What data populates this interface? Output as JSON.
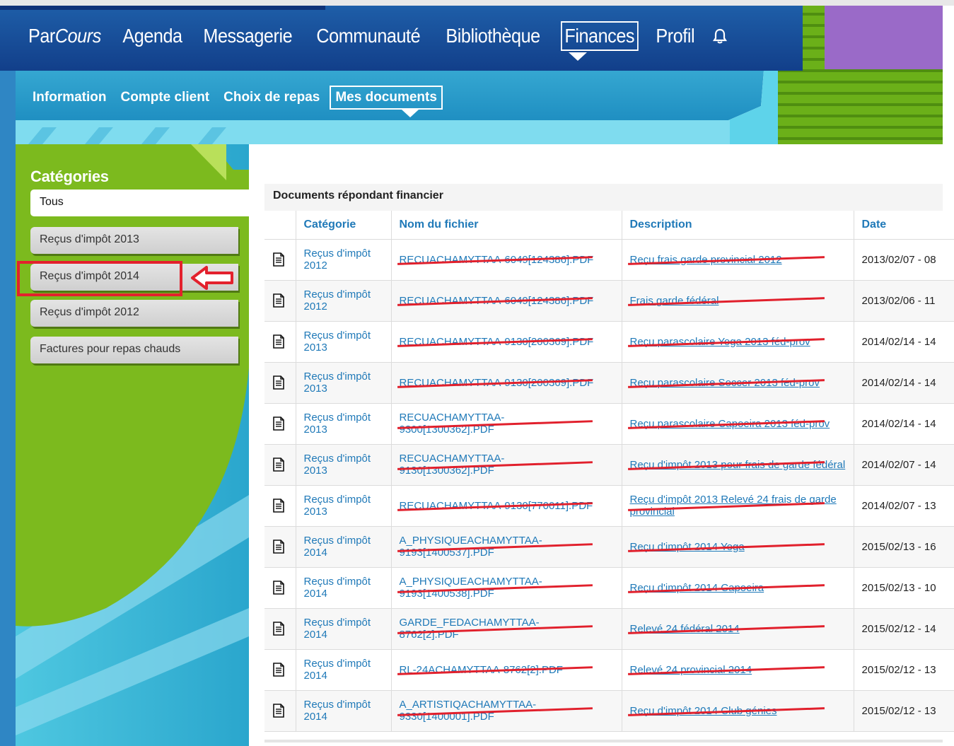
{
  "topnav": {
    "brand_par": "Par",
    "brand_cours": "Cours",
    "items": [
      "Agenda",
      "Messagerie",
      "Communauté",
      "Bibliothèque",
      "Finances",
      "Profil"
    ],
    "active": "Finances"
  },
  "subnav": {
    "items": [
      "Information",
      "Compte client",
      "Choix de repas",
      "Mes documents"
    ],
    "active": "Mes documents"
  },
  "categories": {
    "title": "Catégories",
    "items": [
      "Tous",
      "Reçus d'impôt 2013",
      "Reçus d'impôt 2014",
      "Reçus d'impôt 2012",
      "Factures pour repas chauds"
    ]
  },
  "panel": {
    "title": "Documents répondant financier",
    "columns": [
      "Catégorie",
      "Nom du fichier",
      "Description",
      "Date"
    ]
  },
  "rows": [
    {
      "cat": "Reçus d'impôt 2012",
      "file": "RECUACHAMYTTAA-6049[124386].PDF",
      "desc": "Reçu frais garde provincial 2012",
      "date": "2013/02/07 - 08"
    },
    {
      "cat": "Reçus d'impôt 2012",
      "file": "RECUACHAMYTTAA-6049[124386].PDF",
      "desc": "Frais garde fédéral",
      "date": "2013/02/06 - 11"
    },
    {
      "cat": "Reçus d'impôt 2013",
      "file": "RECUACHAMYTTAA-9130[200369].PDF",
      "desc": "Reçu parascolaire Yoga 2013 féd-prov",
      "date": "2014/02/14 - 14"
    },
    {
      "cat": "Reçus d'impôt 2013",
      "file": "RECUACHAMYTTAA-9130[200369].PDF",
      "desc": "Reçu parascolaire Soccer 2013 féd-prov",
      "date": "2014/02/14 - 14"
    },
    {
      "cat": "Reçus d'impôt 2013",
      "file": "RECUACHAMYTTAA-9300[1300362].PDF",
      "desc": "Reçu parascolaire Capoeira 2013 féd-prov",
      "date": "2014/02/14 - 14"
    },
    {
      "cat": "Reçus d'impôt 2013",
      "file": "RECUACHAMYTTAA-9130[1300362].PDF",
      "desc": "Reçu d'impôt 2013 pour frais de garde fédéral",
      "date": "2014/02/07 - 14"
    },
    {
      "cat": "Reçus d'impôt 2013",
      "file": "RECUACHAMYTTAA-9130[770011].PDF",
      "desc": "Reçu d'impôt 2013 Relevé 24 frais de garde provincial",
      "date": "2014/02/07 - 13"
    },
    {
      "cat": "Reçus d'impôt 2014",
      "file": "A_PHYSIQUEACHAMYTTAA-9193[1400537].PDF",
      "desc": "Reçu d'impôt 2014 Yoga",
      "date": "2015/02/13 - 16"
    },
    {
      "cat": "Reçus d'impôt 2014",
      "file": "A_PHYSIQUEACHAMYTTAA-9193[1400538].PDF",
      "desc": "Reçu d'impôt 2014 Capoeira",
      "date": "2015/02/13 - 10"
    },
    {
      "cat": "Reçus d'impôt 2014",
      "file": "GARDE_FEDACHAMYTTAA-8762[2].PDF",
      "desc": "Relevé 24 fédéral 2014",
      "date": "2015/02/12 - 14"
    },
    {
      "cat": "Reçus d'impôt 2014",
      "file": "RL-24ACHAMYTTAA-8762[2].PDF",
      "desc": "Relevé 24 provincial 2014",
      "date": "2015/02/12 - 13"
    },
    {
      "cat": "Reçus d'impôt 2014",
      "file": "A_ARTISTIQACHAMYTTAA-9330[1400001].PDF",
      "desc": "Reçu d'impôt 2014 Club génies",
      "date": "2015/02/12 - 13"
    }
  ]
}
